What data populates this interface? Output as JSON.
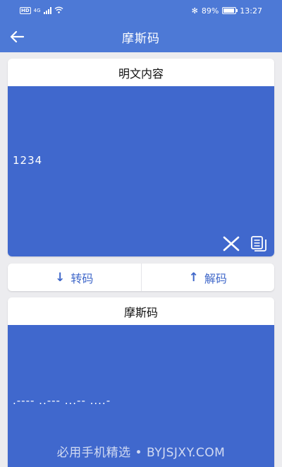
{
  "status": {
    "left_badge": "HD",
    "signal_label": "4G",
    "bluetooth": "✻",
    "battery_percent": "89%",
    "battery_level": 0.89,
    "time": "13:27"
  },
  "app_bar": {
    "title": "摩斯码"
  },
  "plain": {
    "header": "明文内容",
    "value": "1234"
  },
  "actions": {
    "encode_arrow": "↓",
    "encode_label": "转码",
    "decode_arrow": "↑",
    "decode_label": "解码"
  },
  "morse": {
    "header": "摩斯码",
    "value": ".---- ..--- ...-- ....-"
  },
  "watermark": "必用手机精选 • BYJSJXY.COM",
  "colors": {
    "primary": "#4d79d6",
    "panel": "#4068cd",
    "accent_text": "#3f67c9"
  }
}
